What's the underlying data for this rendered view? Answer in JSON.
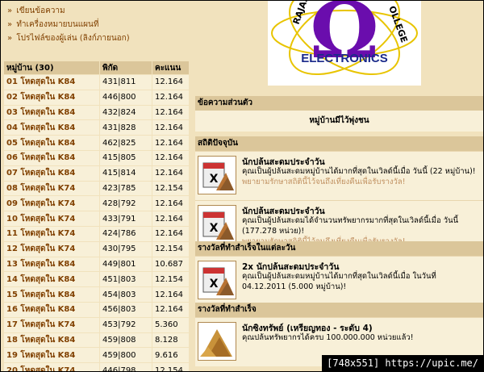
{
  "menu": {
    "items": [
      {
        "label": "เขียนข้อความ"
      },
      {
        "label": "ทำเครื่องหมายบนแผนที่"
      },
      {
        "label": "โปรไฟล์ของผู้เล่น (ลิงก์ภายนอก)"
      }
    ]
  },
  "villages": {
    "headers": {
      "name": "หมู่บ้าน (30)",
      "coords": "พิกัด",
      "points": "คะแนน"
    },
    "rows": [
      {
        "name": "01 โหดสุดใน K84",
        "coords": "431|811",
        "points": "12.164"
      },
      {
        "name": "02 โหดสุดใน K84",
        "coords": "446|800",
        "points": "12.164"
      },
      {
        "name": "03 โหดสุดใน K84",
        "coords": "432|824",
        "points": "12.164"
      },
      {
        "name": "04 โหดสุดใน K84",
        "coords": "431|828",
        "points": "12.164"
      },
      {
        "name": "05 โหดสุดใน K84",
        "coords": "462|825",
        "points": "12.164"
      },
      {
        "name": "06 โหดสุดใน K84",
        "coords": "415|805",
        "points": "12.164"
      },
      {
        "name": "07 โหดสุดใน K84",
        "coords": "415|814",
        "points": "12.164"
      },
      {
        "name": "08 โหดสุดใน K74",
        "coords": "423|785",
        "points": "12.154"
      },
      {
        "name": "09 โหดสุดใน K74",
        "coords": "428|792",
        "points": "12.164"
      },
      {
        "name": "10 โหดสุดใน K74",
        "coords": "433|791",
        "points": "12.164"
      },
      {
        "name": "11 โหดสุดใน K74",
        "coords": "424|786",
        "points": "12.164"
      },
      {
        "name": "12 โหดสุดใน K74",
        "coords": "430|795",
        "points": "12.154"
      },
      {
        "name": "13 โหดสุดใน K84",
        "coords": "449|801",
        "points": "10.687"
      },
      {
        "name": "14 โหดสุดใน K84",
        "coords": "451|803",
        "points": "12.154"
      },
      {
        "name": "15 โหดสุดใน K84",
        "coords": "454|803",
        "points": "12.164"
      },
      {
        "name": "16 โหดสุดใน K84",
        "coords": "456|803",
        "points": "12.164"
      },
      {
        "name": "17 โหดสุดใน K74",
        "coords": "453|792",
        "points": "5.360"
      },
      {
        "name": "18 โหดสุดใน K84",
        "coords": "459|808",
        "points": "8.128"
      },
      {
        "name": "19 โหดสุดใน K84",
        "coords": "459|800",
        "points": "9.616"
      },
      {
        "name": "20 โหดสุดใน K74",
        "coords": "446|798",
        "points": "12.154"
      }
    ]
  },
  "logo": {
    "text": "ELECTRONICS",
    "arc_left": "RAJAS",
    "arc_right": "OLLEGE"
  },
  "message": {
    "header": "ข้อความส่วนตัว",
    "body": "หมู่บ้านมีไว้พุ่งชน"
  },
  "current_stats": {
    "header": "สถิติปัจจุบัน",
    "items": [
      {
        "title": "นักปล้นสะดมประจำวัน",
        "desc": "คุณเป็นผู้ปล้นสะดมหมู่บ้านได้มากที่สุดในเวิลด์นี้เมื่อ วันนี้ (22 หมู่บ้าน)!",
        "hint": "พยายามรักษาสถิตินี้ไว้จนถึงเที่ยงคืนเพื่อรับรางวัล!"
      },
      {
        "title": "นักปล้นสะดมประจำวัน",
        "desc": "คุณเป็นผู้ปล้นสะดมได้จำนวนทรัพยากรมากที่สุดในเวิลด์นี้เมื่อ วันนี้ (177.278 หน่วย)!",
        "hint": "พยายามรักษาสถิตินี้ไว้จนถึงเที่ยงคืนเพื่อรับรางวัล!"
      }
    ]
  },
  "daily_awards": {
    "header": "รางวัลที่ทำสำเร็จในแต่ละวัน",
    "items": [
      {
        "title": "2x นักปล้นสะดมประจำวัน",
        "desc": "คุณเป็นผู้ปล้นสะดมหมู่บ้านได้มากที่สุดในเวิลด์นี้เมื่อ ในวันที่ 04.12.2011 (5.000 หมู่บ้าน)!"
      }
    ]
  },
  "achievements": {
    "header": "รางวัลที่ทำสำเร็จ",
    "items": [
      {
        "title": "นักซิงทรัพย์ (เหรียญทอง - ระดับ 4)",
        "desc": "คุณปล้นทรัพยากรได้ครบ 100.000.000 หน่วยแล้ว!"
      }
    ]
  },
  "watermark": "[748x551] https://upic.me/"
}
